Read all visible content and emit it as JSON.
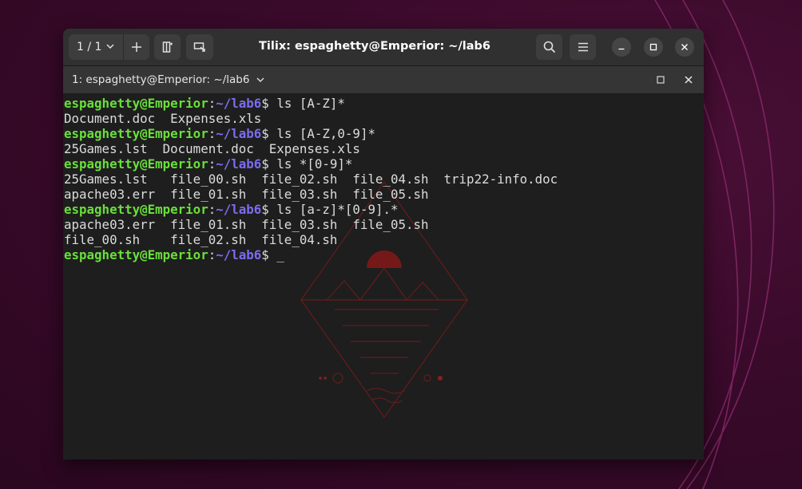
{
  "window": {
    "title": "Tilix: espaghetty@Emperior: ~/lab6",
    "session_label": "1 / 1",
    "icons": [
      "chevron-down-icon",
      "plus-icon",
      "split-terminal-icon",
      "sync-input-icon",
      "search-icon",
      "hamburger-menu-icon",
      "minimize-icon",
      "maximize-icon",
      "close-icon"
    ]
  },
  "tab": {
    "title": "1: espaghetty@Emperior: ~/lab6"
  },
  "colors": {
    "user_host": "#6adf3c",
    "path": "#7b6cf0",
    "text": "#dcdcdc",
    "background": "#1e1e1e"
  },
  "terminal": {
    "prompt_user": "espaghetty@Emperior",
    "prompt_sep": ":",
    "prompt_path": "~/lab6",
    "prompt_end": "$ ",
    "commands": [
      "ls [A-Z]*",
      "ls [A-Z,0-9]*",
      "ls *[0-9]*",
      "ls [a-z]*[0-9].*"
    ],
    "outputs": [
      "Document.doc  Expenses.xls",
      "25Games.lst  Document.doc  Expenses.xls",
      "25Games.lst   file_00.sh  file_02.sh  file_04.sh  trip22-info.doc",
      "apache03.err  file_01.sh  file_03.sh  file_05.sh",
      "apache03.err  file_01.sh  file_03.sh  file_05.sh",
      "file_00.sh    file_02.sh  file_04.sh"
    ],
    "cursor": "_"
  }
}
